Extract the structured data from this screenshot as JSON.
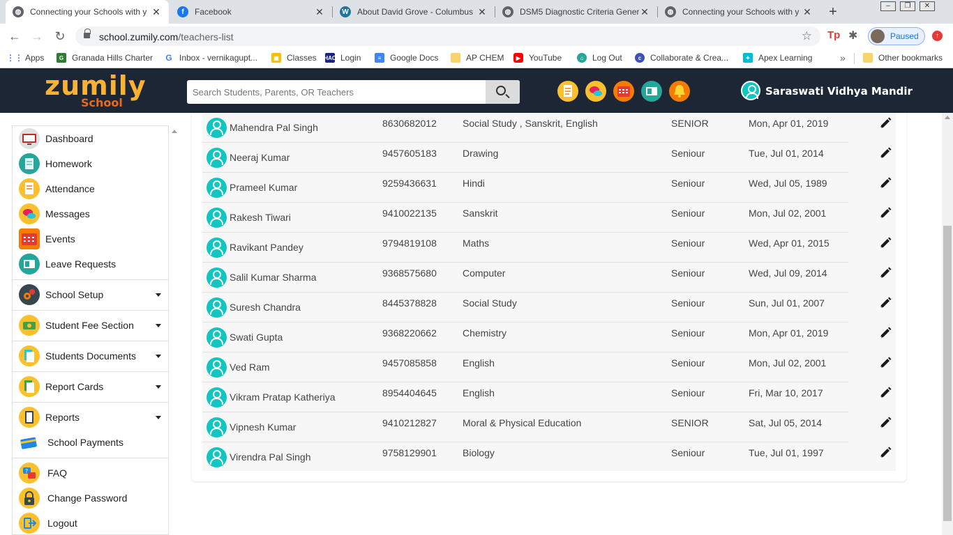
{
  "browser": {
    "tabs": [
      {
        "title": "Connecting your Schools with y",
        "favicon": "globe-icon",
        "active": true
      },
      {
        "title": "Facebook",
        "favicon": "facebook-icon",
        "active": false
      },
      {
        "title": "About David Grove - Columbus",
        "favicon": "wordpress-icon",
        "active": false
      },
      {
        "title": "DSM5 Diagnostic Criteria Gener",
        "favicon": "globe-icon",
        "active": false
      },
      {
        "title": "Connecting your Schools with y",
        "favicon": "globe-icon",
        "active": false
      }
    ],
    "url_domain": "school.zumily.com",
    "url_path": "/teachers-list",
    "profile_label": "Paused",
    "bookmarks": [
      {
        "label": "Apps",
        "icon": "apps-grid-icon"
      },
      {
        "label": "Granada Hills Charter",
        "icon": "granada-icon"
      },
      {
        "label": "Inbox - vernikagupt...",
        "icon": "google-icon"
      },
      {
        "label": "Classes",
        "icon": "classroom-icon"
      },
      {
        "label": "Login",
        "icon": "hac-icon"
      },
      {
        "label": "Google Docs",
        "icon": "docs-icon"
      },
      {
        "label": "AP CHEM",
        "icon": "folder-icon"
      },
      {
        "label": "YouTube",
        "icon": "youtube-icon"
      },
      {
        "label": "Log Out",
        "icon": "logout-site-icon"
      },
      {
        "label": "Collaborate & Crea...",
        "icon": "collaborate-icon"
      },
      {
        "label": "Apex Learning",
        "icon": "apex-icon"
      }
    ],
    "other_bookmarks": "Other bookmarks"
  },
  "header": {
    "logo_main": "zumily",
    "logo_sub": "School",
    "search_placeholder": "Search Students, Parents, OR Teachers",
    "school_name": "Saraswati Vidhya Mandir",
    "accent": "#f9b233",
    "bg": "#1c2634"
  },
  "sidebar": {
    "items": [
      {
        "label": "Dashboard",
        "icon": "dashboard-icon",
        "dropdown": false
      },
      {
        "label": "Homework",
        "icon": "homework-icon",
        "dropdown": false
      },
      {
        "label": "Attendance",
        "icon": "attendance-icon",
        "dropdown": false
      },
      {
        "label": "Messages",
        "icon": "messages-icon",
        "dropdown": false
      },
      {
        "label": "Events",
        "icon": "events-icon",
        "dropdown": false
      },
      {
        "label": "Leave Requests",
        "icon": "leave-requests-icon",
        "dropdown": false
      },
      {
        "label": "School Setup",
        "icon": "school-setup-icon",
        "dropdown": true
      },
      {
        "label": "Student Fee Section",
        "icon": "fee-icon",
        "dropdown": true
      },
      {
        "label": "Students Documents",
        "icon": "documents-icon",
        "dropdown": true
      },
      {
        "label": "Report Cards",
        "icon": "report-cards-icon",
        "dropdown": true
      },
      {
        "label": "Reports",
        "icon": "reports-icon",
        "dropdown": true
      },
      {
        "label": "School Payments",
        "icon": "payments-icon",
        "dropdown": false
      },
      {
        "label": "FAQ",
        "icon": "faq-icon",
        "dropdown": false
      },
      {
        "label": "Change Password",
        "icon": "lock-icon",
        "dropdown": false
      },
      {
        "label": "Logout",
        "icon": "logout-icon",
        "dropdown": false
      }
    ]
  },
  "teachers": [
    {
      "name": "Mahendra Pal Singh",
      "phone": "8630682012",
      "subjects": "Social Study , Sanskrit, English",
      "level": "SENIOR",
      "date": "Mon, Apr 01, 2019"
    },
    {
      "name": "Neeraj Kumar",
      "phone": "9457605183",
      "subjects": "Drawing",
      "level": "Seniour",
      "date": "Tue, Jul 01, 2014"
    },
    {
      "name": "Prameel Kumar",
      "phone": "9259436631",
      "subjects": "Hindi",
      "level": "Seniour",
      "date": "Wed, Jul 05, 1989"
    },
    {
      "name": "Rakesh Tiwari",
      "phone": "9410022135",
      "subjects": "Sanskrit",
      "level": "Seniour",
      "date": "Mon, Jul 02, 2001"
    },
    {
      "name": "Ravikant Pandey",
      "phone": "9794819108",
      "subjects": "Maths",
      "level": "Seniour",
      "date": "Wed, Apr 01, 2015"
    },
    {
      "name": "Salil Kumar Sharma",
      "phone": "9368575680",
      "subjects": "Computer",
      "level": "Seniour",
      "date": "Wed, Jul 09, 2014"
    },
    {
      "name": "Suresh Chandra",
      "phone": "8445378828",
      "subjects": "Social Study",
      "level": "Seniour",
      "date": "Sun, Jul 01, 2007"
    },
    {
      "name": "Swati Gupta",
      "phone": "9368220662",
      "subjects": "Chemistry",
      "level": "Seniour",
      "date": "Mon, Apr 01, 2019"
    },
    {
      "name": "Ved Ram",
      "phone": "9457085858",
      "subjects": "English",
      "level": "Seniour",
      "date": "Mon, Jul 02, 2001"
    },
    {
      "name": "Vikram Pratap Katheriya",
      "phone": "8954404645",
      "subjects": "English",
      "level": "Seniour",
      "date": "Fri, Mar 10, 2017"
    },
    {
      "name": "Vipnesh Kumar",
      "phone": "9410212827",
      "subjects": "Moral & Physical Education",
      "level": "SENIOR",
      "date": "Sat, Jul 05, 2014"
    },
    {
      "name": "Virendra Pal Singh",
      "phone": "9758129901",
      "subjects": "Biology",
      "level": "Seniour",
      "date": "Tue, Jul 01, 1997"
    }
  ]
}
